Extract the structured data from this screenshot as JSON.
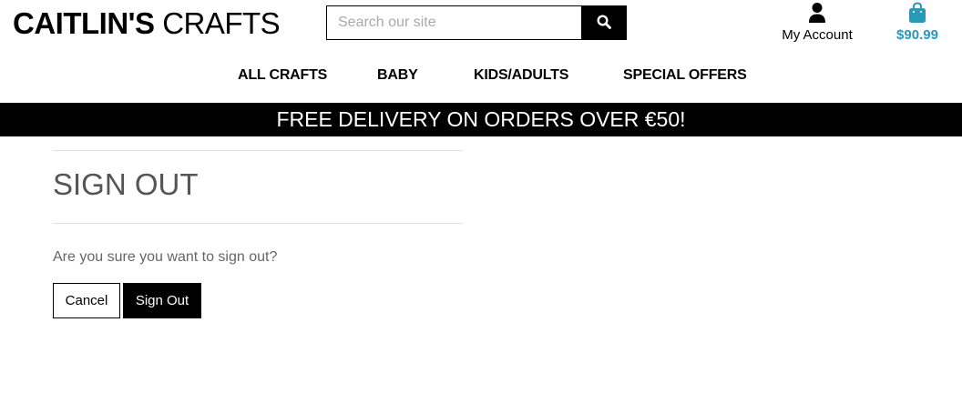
{
  "header": {
    "logo_bold": "CAITLIN'S",
    "logo_light": "CRAFTS",
    "search": {
      "placeholder": "Search our site",
      "value": ""
    },
    "account": {
      "label": "My Account",
      "icon": "user-icon"
    },
    "cart": {
      "total": "$90.99",
      "icon": "shopping-bag-icon",
      "color": "#2a98b8"
    }
  },
  "nav": {
    "items": [
      {
        "label": "ALL CRAFTS"
      },
      {
        "label": "BABY"
      },
      {
        "label": "KIDS/ADULTS"
      },
      {
        "label": "SPECIAL OFFERS"
      }
    ]
  },
  "banner": {
    "text": "FREE DELIVERY ON ORDERS OVER €50!"
  },
  "main": {
    "title": "SIGN OUT",
    "question": "Are you sure you want to sign out?",
    "cancel_label": "Cancel",
    "signout_label": "Sign Out"
  }
}
